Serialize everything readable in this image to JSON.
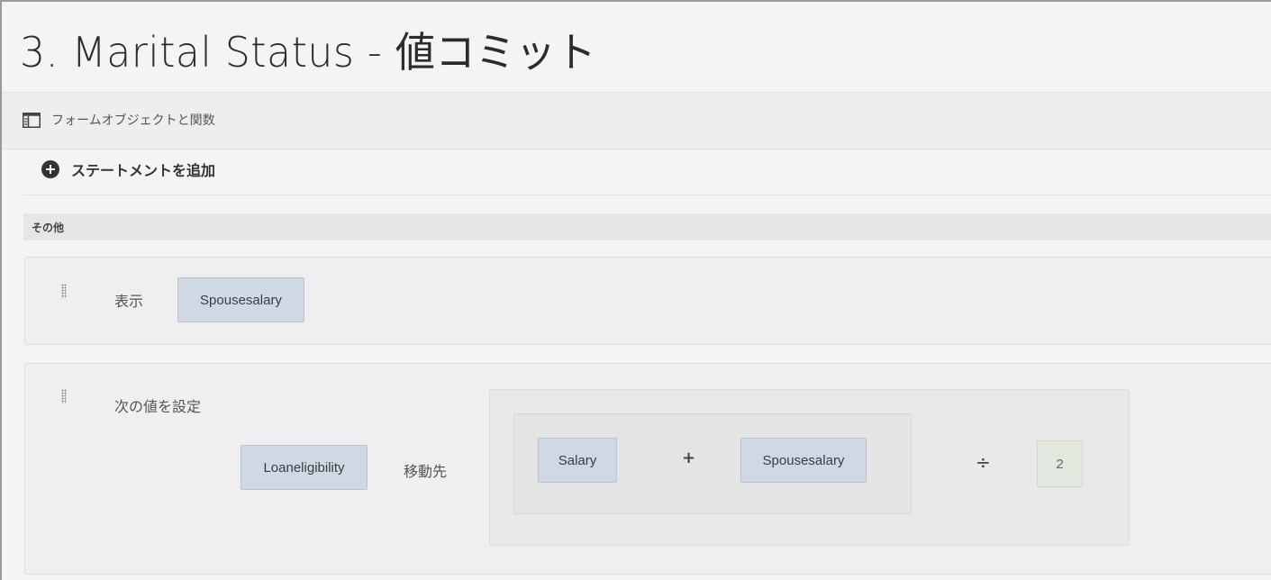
{
  "page": {
    "title": "3. Marital Status - 値コミット"
  },
  "toolbar": {
    "forms_objects_label": "フォームオブジェクトと関数",
    "icon": "panel-icon"
  },
  "actions": {
    "add_statement_label": "ステートメントを追加",
    "icon": "plus-circle-icon"
  },
  "section": {
    "label": "その他"
  },
  "statements": [
    {
      "action_label": "表示",
      "target": "Spousesalary"
    },
    {
      "action_label": "次の値を設定",
      "target": "Loaneligibility",
      "connector_label": "移動先",
      "expression": {
        "left_operand": "Salary",
        "inner_operator": "+",
        "right_operand": "Spousesalary",
        "outer_operator": "÷",
        "divisor": "2"
      }
    }
  ],
  "colors": {
    "token_bg": "#cfd9e6",
    "number_token_bg": "#e1e8dd",
    "page_bg": "#f4f4f4"
  }
}
